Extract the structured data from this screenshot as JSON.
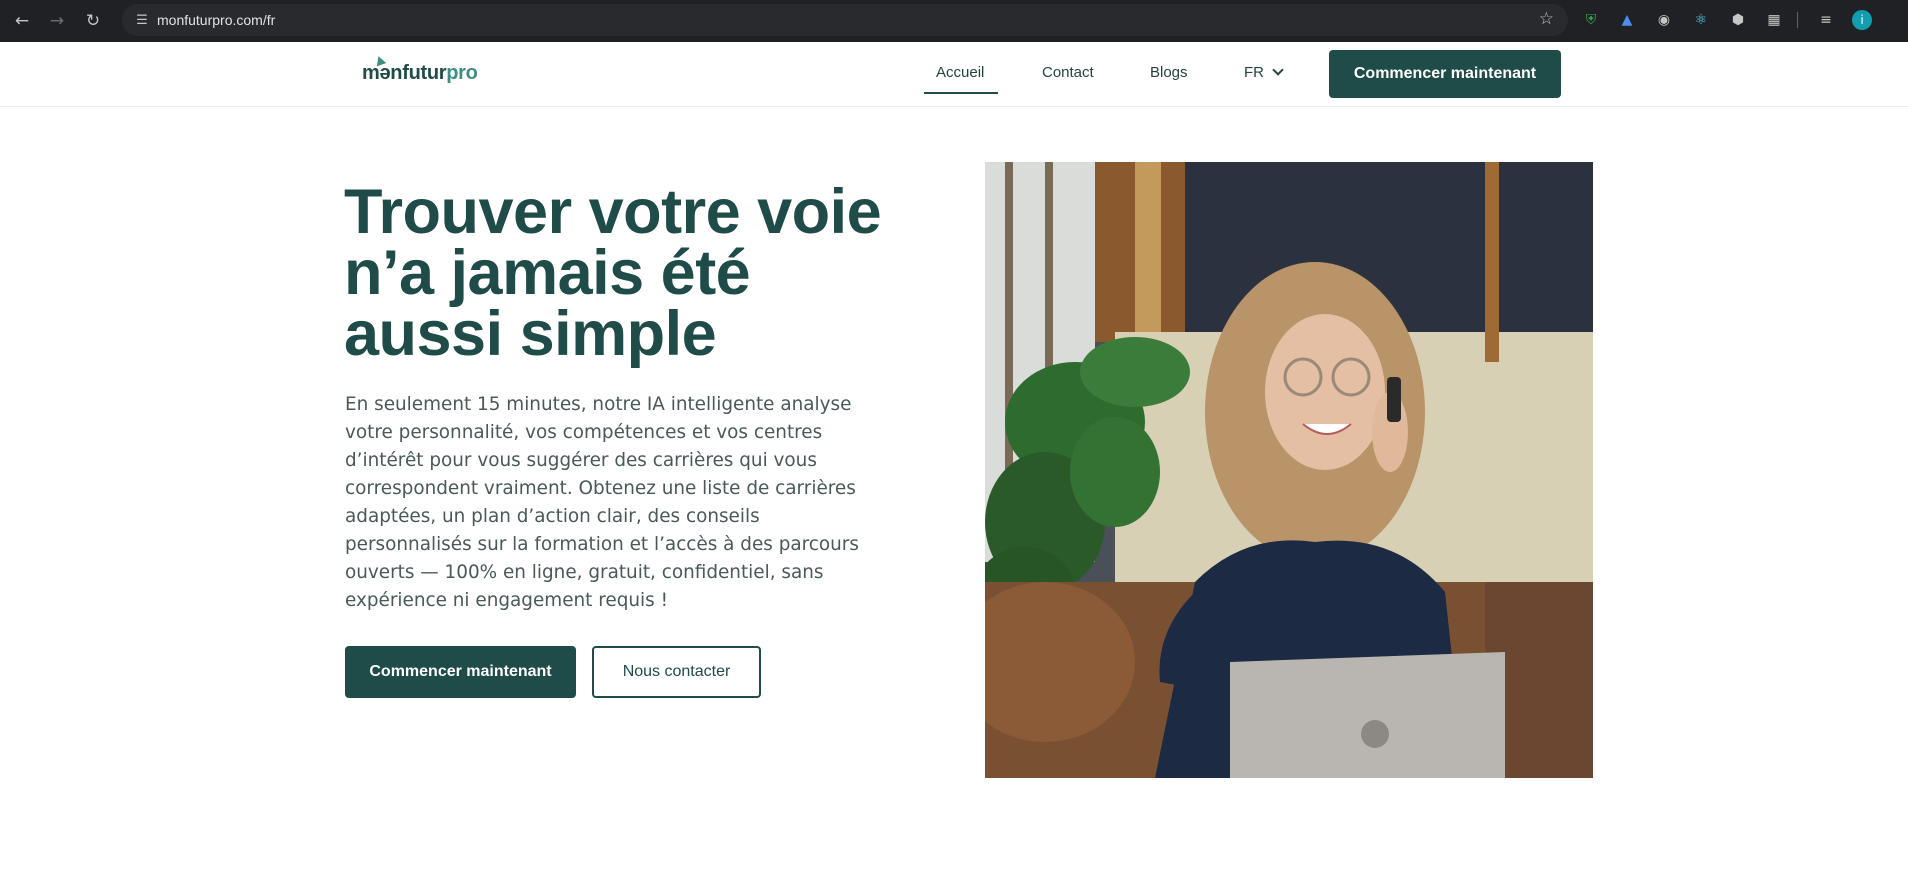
{
  "browser": {
    "url": "monfuturpro.com/fr",
    "profile_initial": "i"
  },
  "header": {
    "logo_main": "mənfutur",
    "logo_accent": "pro",
    "nav": [
      "Accueil",
      "Contact",
      "Blogs"
    ],
    "active_nav": "Accueil",
    "language": "FR",
    "cta_label": "Commencer maintenant"
  },
  "hero": {
    "title": "Trouver votre voie n’a jamais été aussi simple",
    "description": "En seulement 15 minutes, notre IA intelligente analyse votre personnalité, vos compétences et vos centres d’intérêt pour vous suggérer des carrières qui vous correspondent vraiment. Obtenez une liste de carrières adaptées, un plan d’action clair, des conseils personnalisés sur la formation et l’accès à des parcours ouverts — 100% en ligne, gratuit, confidentiel, sans expérience ni engagement requis !",
    "primary_button": "Commencer maintenant",
    "secondary_button": "Nous contacter"
  },
  "colors": {
    "brand_dark": "#1f4b48",
    "brand_accent": "#3d8f86",
    "text_body": "#4a5858"
  },
  "icons": {
    "back": "arrow-left-icon",
    "forward": "arrow-right-icon",
    "reload": "reload-icon",
    "site_info": "tune-icon",
    "bookmark": "star-icon",
    "language_chevron": "chevron-down-icon"
  }
}
